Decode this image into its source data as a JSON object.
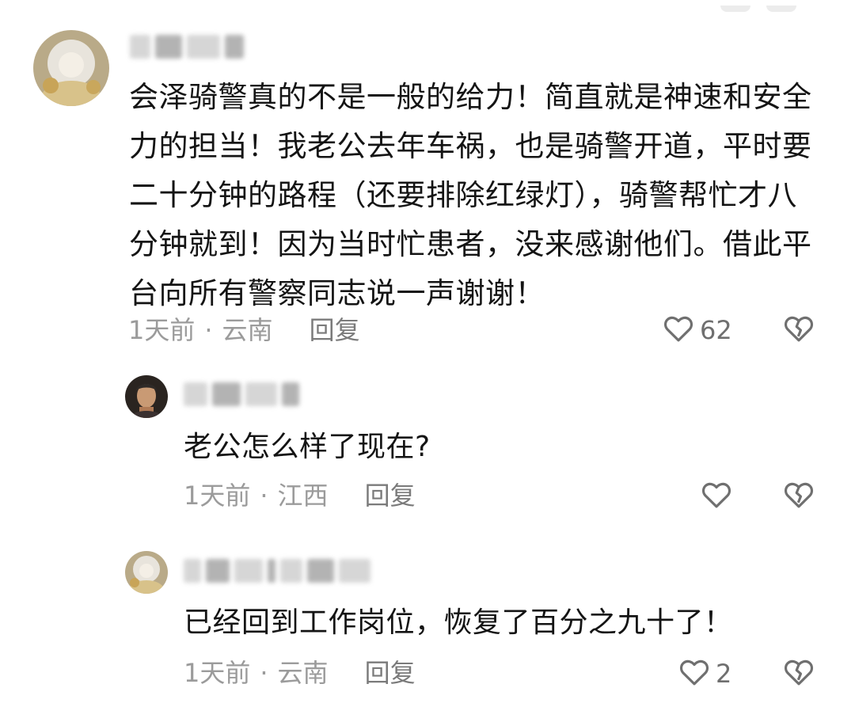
{
  "comments": [
    {
      "text": "会泽骑警真的不是一般的给力！简直就是神速和安全力的担当！我老公去年车祸，也是骑警开道，平时要二十分钟的路程（还要排除红绿灯），骑警帮忙才八分钟就到！因为当时忙患者，没来感谢他们。借此平台向所有警察同志说一声谢谢！",
      "time": "1天前",
      "separator": "·",
      "location": "云南",
      "reply_label": "回复",
      "likes": "62"
    },
    {
      "text": "老公怎么样了现在?",
      "time": "1天前",
      "separator": "·",
      "location": "江西",
      "reply_label": "回复",
      "likes": ""
    },
    {
      "text": "已经回到工作岗位，恢复了百分之九十了！",
      "time": "1天前",
      "separator": "·",
      "location": "云南",
      "reply_label": "回复",
      "likes": "2"
    }
  ],
  "icons": {
    "like": "heart-outline-icon",
    "dislike": "broken-heart-icon"
  },
  "colors": {
    "text": "#141414",
    "meta": "#9b9b9b",
    "icon": "#6f6f6f"
  }
}
